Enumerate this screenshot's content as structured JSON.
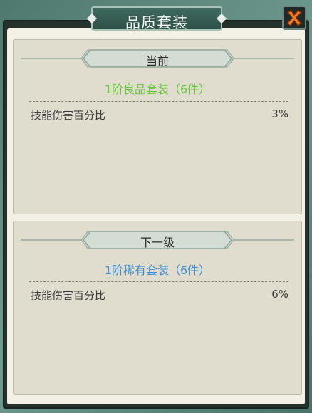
{
  "window": {
    "title": "品质套装"
  },
  "current": {
    "header": "当前",
    "set_name": "1阶良品套装（6件）",
    "attr_label": "技能伤害百分比",
    "attr_value": "3%"
  },
  "next": {
    "header": "下一级",
    "set_name": "1阶稀有套装（6件）",
    "attr_label": "技能伤害百分比",
    "attr_value": "6%"
  },
  "colors": {
    "current_set": "#63c53a",
    "next_set": "#3f8ed6"
  },
  "icons": {
    "close": "close-x-icon"
  }
}
